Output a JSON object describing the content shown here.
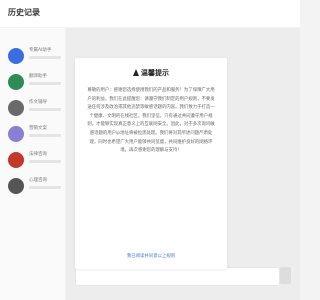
{
  "header": {
    "title": "历史记录"
  },
  "sidebar": {
    "items": [
      {
        "label": "专属AI助手",
        "icon": "assistant-avatar-icon",
        "color": "#3b6fe0"
      },
      {
        "label": "翻译助手",
        "icon": "translate-avatar-icon",
        "color": "#2e8b57"
      },
      {
        "label": "作文辅导",
        "icon": "writing-avatar-icon",
        "color": "#6a6a6a"
      },
      {
        "label": "营销文案",
        "icon": "marketing-avatar-icon",
        "color": "#8a7fd0"
      },
      {
        "label": "法律咨询",
        "icon": "law-avatar-icon",
        "color": "#c0392b"
      },
      {
        "label": "心理咨询",
        "icon": "counsel-avatar-icon",
        "color": "#555555"
      }
    ]
  },
  "modal": {
    "title": "温馨提示",
    "icon": "warning-icon",
    "body": "尊敬的用户：感谢您选择使用我们的产品和服务！为了保障广大用户的利益，我们在此提醒您：请遵守我们制定的用户规则，不要发送任何涉及政治或其他违禁等敏感话题的内容。我们致力于打造一个健康、文明的在线社区。我们坚信，只有通过共同遵守用户规则，才能够实现真正意义上的互联网安全。因此，对于多次询问敏感话题的用户ip地址将被拉黑处理。我们将对其所述问题严肃处理，同时也希望广大用户能够共同监督，共同维护良好的网络环境。再次感谢您的理解与支持！",
    "link_label": "我已阅读并同意以上规则"
  }
}
